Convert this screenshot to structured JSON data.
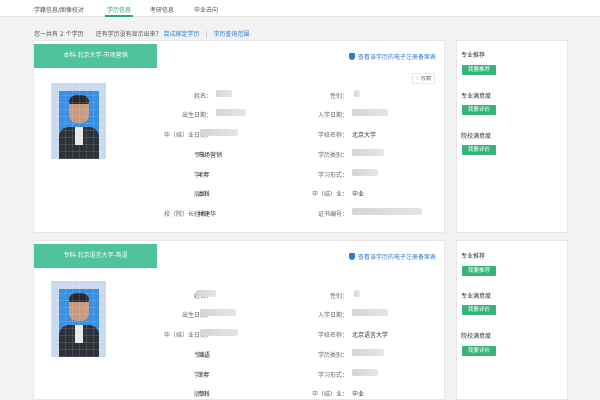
{
  "nav": {
    "tabs": [
      {
        "label": "学籍信息/图像校对"
      },
      {
        "label": "学历信息"
      },
      {
        "label": "考研信息"
      },
      {
        "label": "毕业去向"
      }
    ]
  },
  "summary": {
    "count_text": "您一共有 2 个学历",
    "question": "还有学历没有显示出来？",
    "bind_link": "尝试绑定学历",
    "scope_link": "学历查询范围"
  },
  "records": [
    {
      "ribbon": "本科-北京大学-市场营销",
      "register_link": "查看该学历的电子注册备案表",
      "favorite": "收藏",
      "labels": {
        "name": "姓名：",
        "gender": "性别：",
        "birth": "出生日期：",
        "enroll": "入学日期：",
        "grad": "毕（结）业日期：",
        "school": "学校名称：",
        "major": "专业：",
        "edu_type": "学历类别：",
        "duration": "学制：",
        "study_form": "学习形式：",
        "level": "层次：",
        "status": "毕（结）业：",
        "principal": "校（院）长姓名：",
        "cert_no": "证书编号："
      },
      "values": {
        "school": "北京大学",
        "major": "市场营销",
        "duration": "4 年",
        "level": "本科",
        "status": "毕业",
        "principal": "林建华"
      }
    },
    {
      "ribbon": "专科-北京语言大学-英语",
      "register_link": "查看该学历的电子注册备案表",
      "labels": {
        "name": "姓名：",
        "gender": "性别：",
        "birth": "出生日期：",
        "enroll": "入学日期：",
        "grad": "毕（结）业日期：",
        "school": "学校名称：",
        "major": "专业：",
        "edu_type": "学历类别：",
        "duration": "学制：",
        "study_form": "学习形式：",
        "level": "层次：",
        "status": "毕（结）业："
      },
      "values": {
        "school": "北京语言大学",
        "major": "英语",
        "duration": "3 年",
        "level": "专科",
        "status": "毕业"
      }
    }
  ],
  "sidebar": [
    {
      "sections": [
        {
          "title": "专业推荐",
          "button": "我要推荐"
        },
        {
          "title": "专业满意度",
          "button": "我要评价"
        },
        {
          "title": "院校满意度",
          "button": "我要评价"
        }
      ]
    },
    {
      "sections": [
        {
          "title": "专业推荐",
          "button": "我要推荐"
        },
        {
          "title": "专业满意度",
          "button": "我要评价"
        },
        {
          "title": "院校满意度",
          "button": "我要评价"
        }
      ]
    }
  ],
  "colors": {
    "accent": "#2aa876",
    "ribbon": "#4fc49a",
    "button": "#37b37e",
    "link": "#2b7bd8"
  }
}
